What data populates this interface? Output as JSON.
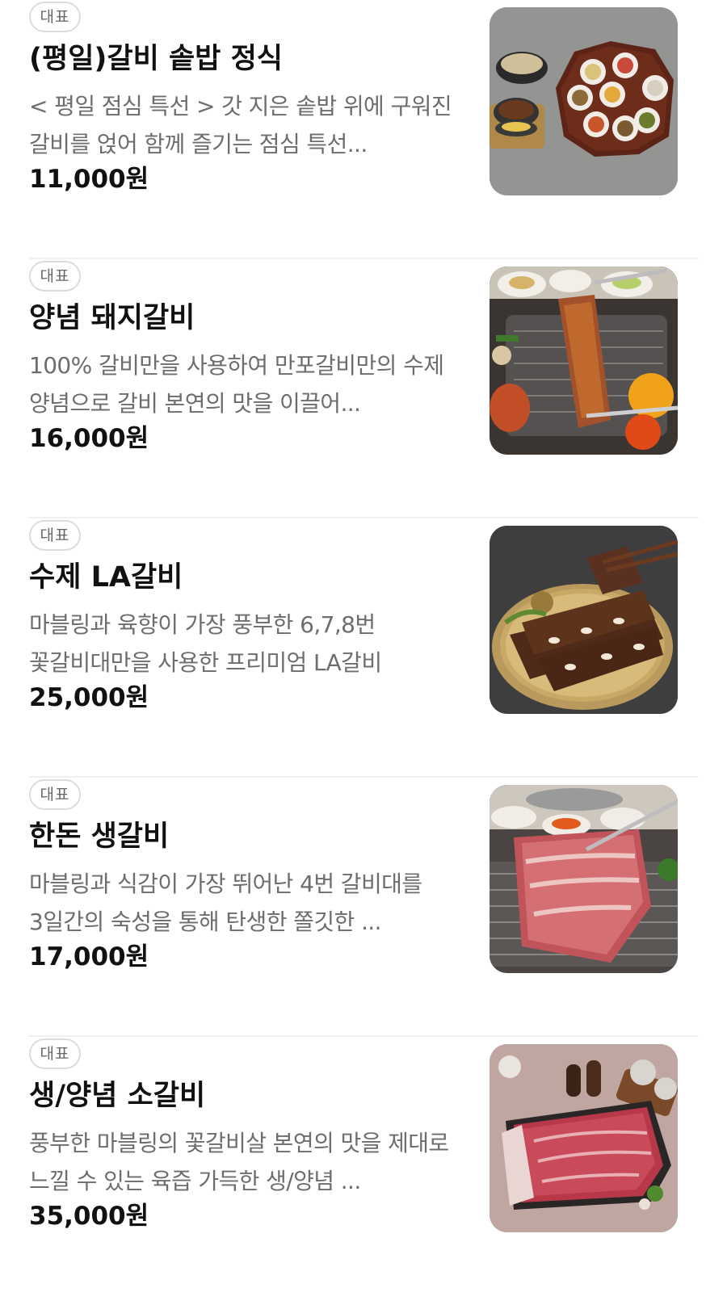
{
  "menu": {
    "items": [
      {
        "badge": "대표",
        "title": "(평일)갈비 솥밥 정식",
        "description": "< 평일 점심 특선 > 갓 지은 솥밥 위에 구워진 갈비를 얹어 함께 즐기는 점심 특선...",
        "price": "11,000원",
        "image": "galbi-sotbap-set-photo"
      },
      {
        "badge": "대표",
        "title": "양념 돼지갈비",
        "description": "100% 갈비만을 사용하여 만포갈비만의 수제 양념으로 갈비 본연의 맛을 이끌어...",
        "price": "16,000원",
        "image": "marinated-pork-ribs-photo"
      },
      {
        "badge": "대표",
        "title": "수제 LA갈비",
        "description": "마블링과 육향이 가장 풍부한 6,7,8번 꽃갈비대만을 사용한 프리미엄 LA갈비",
        "price": "25,000원",
        "image": "la-galbi-photo"
      },
      {
        "badge": "대표",
        "title": "한돈 생갈비",
        "description": "마블링과 식감이 가장 뛰어난 4번 갈비대를 3일간의 숙성을 통해 탄생한 쫄깃한 ...",
        "price": "17,000원",
        "image": "fresh-pork-ribs-photo"
      },
      {
        "badge": "대표",
        "title": "생/양념 소갈비",
        "description": "풍부한 마블링의 꽃갈비살 본연의 맛을 제대로 느낄 수 있는 육즙 가득한 생/양념 ...",
        "price": "35,000원",
        "image": "beef-ribs-photo"
      }
    ]
  }
}
